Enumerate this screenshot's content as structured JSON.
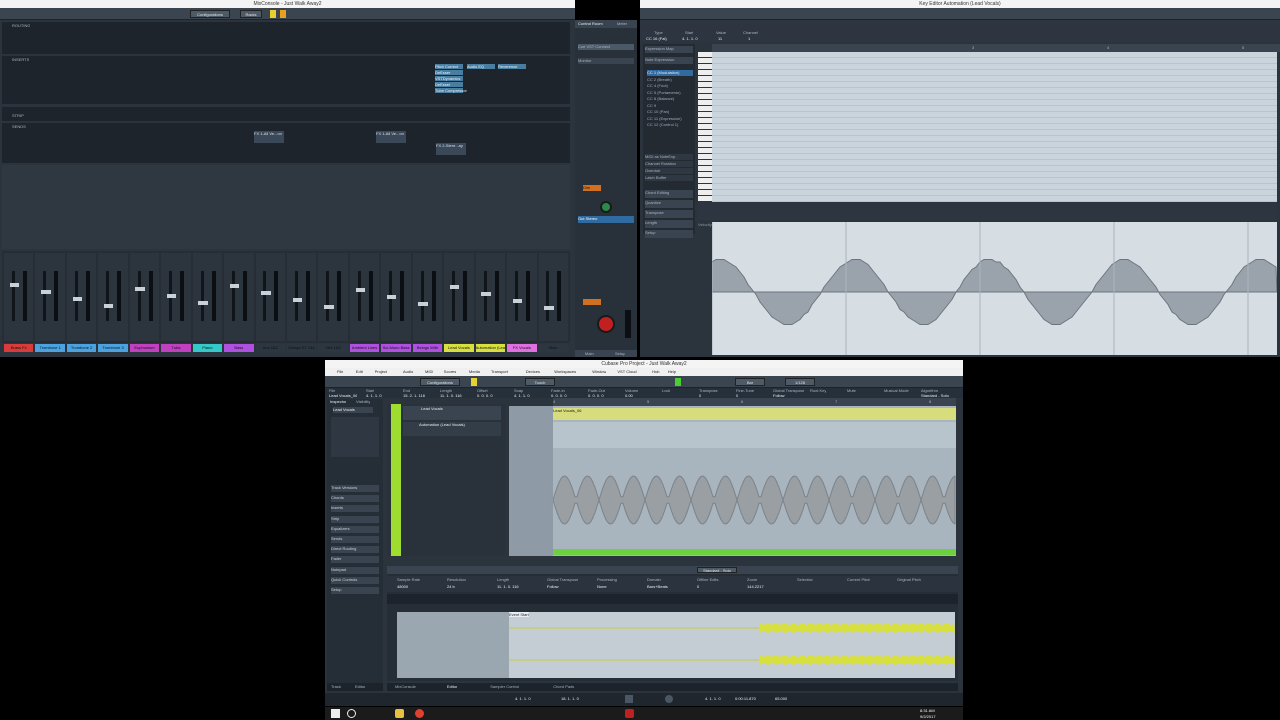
{
  "mixconsole": {
    "title": "MixConsole - Just Walk Away2",
    "configurations_label": "Configurations",
    "rack_label": "Racks",
    "sections": {
      "routing": "ROUTING",
      "inserts": "INSERTS",
      "sends": "SENDS",
      "strip": "STRIP"
    },
    "insert_items": [
      "Pitch Correct",
      "DeEsser",
      "VSTDynamics",
      "DeEsser",
      "Tube Compressor",
      "Audio EQ",
      "Reverence"
    ],
    "send_items": [
      "FX 1-All Ve...on",
      "FX 1-All Ve...on",
      "FX 2-Stere...ay"
    ],
    "channels": [
      {
        "name": "Brass Fx",
        "color": "#d83b3b"
      },
      {
        "name": "Trombone 1",
        "color": "#4aa3e0"
      },
      {
        "name": "Trombone 2",
        "color": "#4aa3e0"
      },
      {
        "name": "Trombone 3",
        "color": "#4aa3e0"
      },
      {
        "name": "Euphonium",
        "color": "#c040c0"
      },
      {
        "name": "Tuba",
        "color": "#c040c0"
      },
      {
        "name": "Piano",
        "color": "#34c8c8"
      },
      {
        "name": "Bass",
        "color": "#b050e0"
      },
      {
        "name": "Aux 1&2",
        "color": "#2b3640"
      },
      {
        "name": "Delays ST 1&2",
        "color": "#2b3640"
      },
      {
        "name": "Hits 1&2",
        "color": "#2b3640"
      },
      {
        "name": "Ambient Lines",
        "color": "#b050e0"
      },
      {
        "name": "Sci-Mono Bass",
        "color": "#b050e0"
      },
      {
        "name": "Beings With",
        "color": "#b050e0"
      },
      {
        "name": "Lead Vocals",
        "color": "#d8e040"
      },
      {
        "name": "Automation (Lead Vocals)",
        "color": "#d8e040"
      },
      {
        "name": "FX Vocals",
        "color": "#e070e0"
      },
      {
        "name": "Main",
        "color": "#2b3640"
      }
    ]
  },
  "control_room": {
    "tabs": [
      "Control Room",
      "Meter"
    ],
    "cue_label": "Cue VST Connect",
    "monitor_label": "Monitor",
    "main_label": "Main",
    "setup_label": "Setup",
    "stereo_label": "Out Stereo",
    "dim_label": "Dim"
  },
  "key_editor": {
    "title": "Key Editor Automation (Lead Vocals)",
    "info_labels": [
      "Type",
      "Start",
      "Value",
      "Channel"
    ],
    "info_values": [
      "CC 16 (Fal)",
      "4. 1. 1. 0",
      "11",
      "1"
    ],
    "ruler_marks": [
      "3",
      "4",
      "5"
    ],
    "expression_map_label": "Expression Map",
    "note_expression_label": "Note Expression",
    "cc_items": [
      "CC 1 (Modulation)",
      "CC 2 (Breath)",
      "CC 4 (Foot)",
      "CC 5 (Portamento)",
      "CC 8 (Balance)",
      "CC 9",
      "CC 10 (Pan)",
      "CC 11 (Expression)",
      "CC 12 (Control 1)"
    ],
    "side_items": [
      "MIDI as NoteExp.",
      "Channel Rotation",
      "Overdub",
      "Latch Buffer"
    ],
    "sections": [
      "Chord Editing",
      "Quantize",
      "Transpose",
      "Length",
      "Setup"
    ],
    "velocity_label": "Velocity"
  },
  "project": {
    "title": "Cubase Pro Project - Just Walk Away2",
    "menu": [
      "File",
      "Edit",
      "Project",
      "Audio",
      "MIDI",
      "Scores",
      "Media",
      "Transport",
      "Devices",
      "Workspaces",
      "Window",
      "VST Cloud",
      "Hub",
      "Help"
    ],
    "configurations_label": "Configurations",
    "touch_label": "Touch",
    "grid_label": "Bar",
    "quantize_label": "1/128",
    "info_headers": [
      "File",
      "Start",
      "End",
      "Length",
      "Offset",
      "Snap",
      "Fade-In",
      "Fade-Out",
      "Volume",
      "Lock",
      "Transpose",
      "Fine-Tune",
      "Global Transpose",
      "Root Key",
      "Mute",
      "Musical Mode",
      "Algorithm"
    ],
    "info_values": [
      "Lead Vocals_06",
      "4. 1. 1. 0",
      "15. 2. 1. 116",
      "11. 1. 0. 116",
      "0. 0. 0. 0",
      "4. 1. 1. 0",
      "0. 0. 0. 0",
      "0. 0. 0. 0",
      "0.00",
      "",
      "0",
      "0",
      "Follow",
      "",
      "",
      "",
      "Standard - Solo"
    ],
    "inspector_tabs": [
      "Inspector",
      "Visibility"
    ],
    "inspector_track": "Lead Vocals",
    "inspector_sections": [
      "Track Versions",
      "Chords",
      "Inserts",
      "Strip",
      "Equalizers",
      "Sends",
      "Direct Routing",
      "Fader",
      "Notepad",
      "Quick Controls",
      "Setup"
    ],
    "tracks": [
      {
        "name": "Lead Vocals",
        "color": "#b8e030"
      },
      {
        "name": "Automation (Lead Vocals)",
        "color": "#b8e030"
      }
    ],
    "event_label": "Lead Vocals_06",
    "ruler_marks": [
      "4",
      "5",
      "6",
      "7",
      "8"
    ],
    "lower_zone": {
      "tabs": [
        "MixConsole",
        "Editor",
        "Sampler Control",
        "Chord Pads"
      ],
      "bottom_tabs": [
        "Track",
        "Editor"
      ],
      "headers": [
        "Sample Rate",
        "Resolution",
        "Length",
        "Global Transpose",
        "Processing",
        "Domain",
        "Offline Edits",
        "Zoom",
        "Selection",
        "Current Pitch",
        "Original Pitch"
      ],
      "values": [
        "48000",
        "24 b",
        "11. 1. 0. 116",
        "Follow",
        "None",
        "Bars+Beats",
        "0",
        "144.2217",
        "",
        "",
        ""
      ],
      "standard_label": "Standard - Solo",
      "event_tag": "Event Start"
    },
    "transport": {
      "position": "4. 1. 1. 0",
      "end_position": "18. 1. 1. 0",
      "locator_left": "4. 1. 1. 0",
      "time": "0:00:11.870",
      "tempo": "65.000"
    }
  },
  "taskbar": {
    "time": "8:31 AM",
    "date": "9/2/2017"
  }
}
